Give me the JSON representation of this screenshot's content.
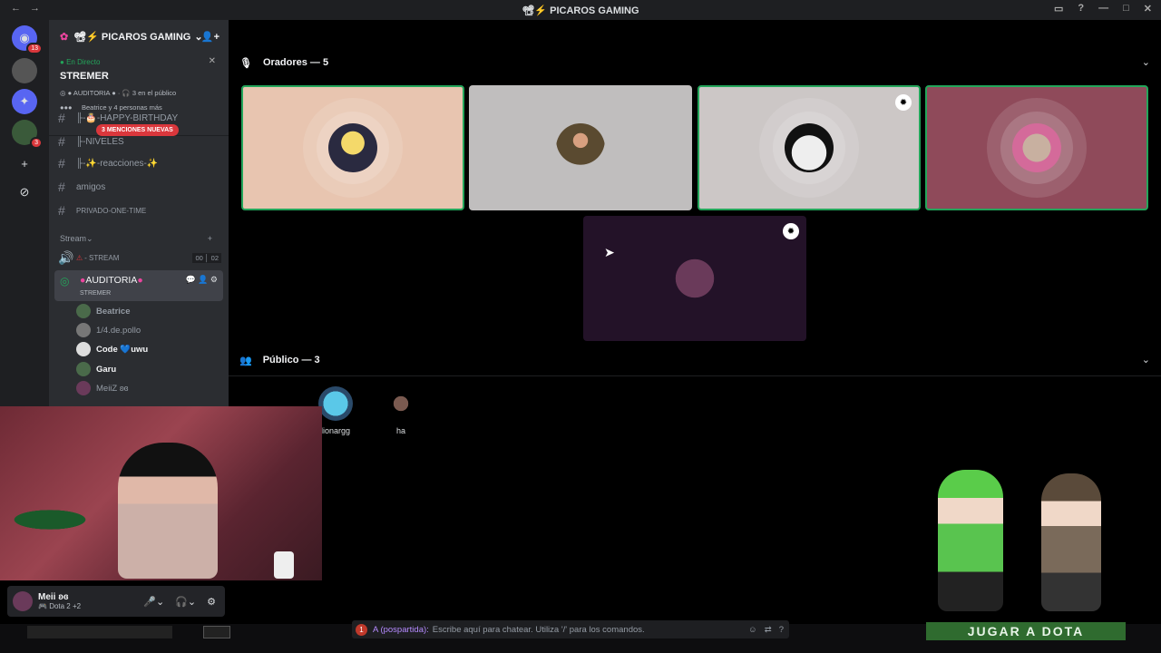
{
  "titlebar": {
    "title": "📽⚡ PICAROS GAMING"
  },
  "guilds": {
    "notif_count": "13",
    "badge2": "3"
  },
  "server": {
    "name": "📽⚡ PICAROS GAMING"
  },
  "live": {
    "status": "En Directo",
    "stage_name": "STREMER",
    "channel": "AUDITORIA",
    "audience": "3 en el público",
    "people": "Beatrice y 4 personas más"
  },
  "mentions_badge": "3 MENCIONES NUEVAS",
  "channels": [
    {
      "name": "╟-🎂-HAPPY-BIRTHDAY"
    },
    {
      "name": "╟-NIVELES"
    },
    {
      "name": "╟-✨-reacciones-✨"
    },
    {
      "name": "amigos"
    },
    {
      "name": "PRIVADO-ONE-TIME"
    }
  ],
  "category": {
    "name": "Stream"
  },
  "voice": {
    "stream": "- STREAM",
    "count_a": "00",
    "count_b": "02",
    "auditoria": "AUDITORIA",
    "sub": "STREMER"
  },
  "voice_users": [
    {
      "name": "Beatrice",
      "color": "#f2f3f5"
    },
    {
      "name": "1/4.de.pollo",
      "color": "#949ba4"
    },
    {
      "name": "Code 💙uwu",
      "color": "#f2f3f5"
    },
    {
      "name": "Garu",
      "color": "#f2f3f5"
    },
    {
      "name": "MeiiZ ʚɞ",
      "color": "#949ba4"
    }
  ],
  "speakers": {
    "header": "Oradores — 5"
  },
  "audience": {
    "header": "Público — 3",
    "users": [
      "lionargg",
      "ha"
    ]
  },
  "user_panel": {
    "name": "Meii ʚɞ",
    "status": "Dota 2 +2"
  },
  "chat": {
    "badge": "1",
    "prefix": "A (pospartida):",
    "placeholder": "Escribe aquí para chatear. Utiliza '/' para los comandos."
  },
  "overlay": {
    "button": "JUGAR A DOTA"
  },
  "colors": {
    "accent": "#23a55a",
    "mention": "#da373c"
  }
}
